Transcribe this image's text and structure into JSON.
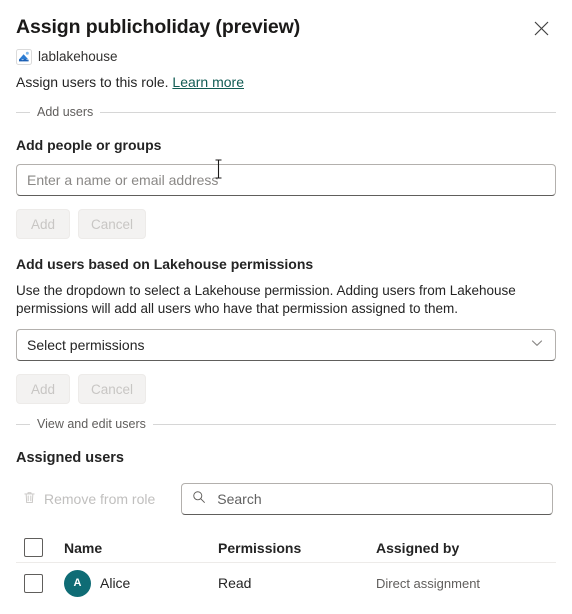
{
  "header": {
    "title": "Assign publicholiday (preview)",
    "item_icon": "lakehouse-icon",
    "item_name": "lablakehouse",
    "description": "Assign users to this role.",
    "learn_more": "Learn more",
    "close_icon": "close-icon"
  },
  "add_users_section": {
    "legend": "Add users",
    "people_label": "Add people or groups",
    "people_placeholder": "Enter a name or email address",
    "people_value": "",
    "add_label": "Add",
    "cancel_label": "Cancel"
  },
  "permissions_section": {
    "heading": "Add users based on Lakehouse permissions",
    "helper": "Use the dropdown to select a Lakehouse permission. Adding users from Lakehouse permissions will add all users who have that permission assigned to them.",
    "dropdown_value": "Select permissions",
    "dropdown_icon": "chevron-down-icon",
    "add_label": "Add",
    "cancel_label": "Cancel"
  },
  "view_edit_section": {
    "legend": "View and edit users",
    "assigned_users_title": "Assigned users",
    "remove_label": "Remove from role",
    "remove_icon": "trash-icon",
    "search_icon": "search-icon",
    "search_placeholder": "Search",
    "search_value": ""
  },
  "table": {
    "columns": [
      "Name",
      "Permissions",
      "Assigned by"
    ],
    "rows": [
      {
        "initial": "A",
        "name": "Alice",
        "permissions": "Read",
        "assigned_by": "Direct assignment"
      }
    ]
  },
  "colors": {
    "link": "#115c54",
    "avatar": "#0f6c75",
    "text": "#242424",
    "muted": "#605e5c",
    "border": "#b3b0ad"
  }
}
